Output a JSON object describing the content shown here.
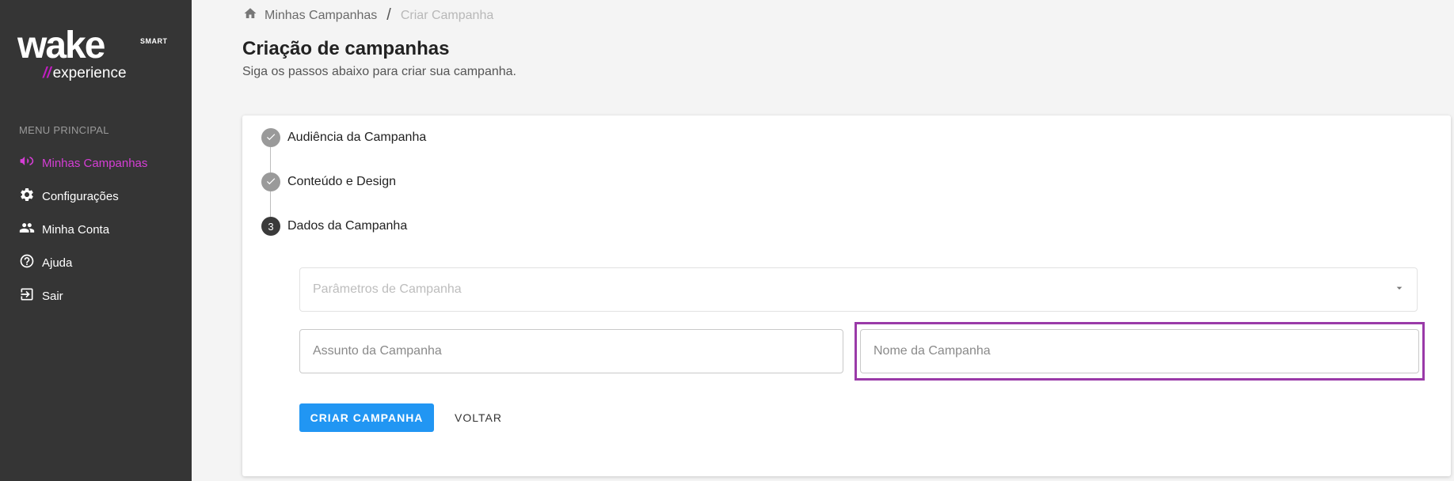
{
  "brand": {
    "logo_word": "wake",
    "logo_smart": "SMART",
    "logo_sub_slashes": "//",
    "logo_sub": "experience",
    "accent_color": "#c21ec2"
  },
  "sidebar": {
    "section_title": "MENU PRINCIPAL",
    "items": [
      {
        "label": "Minhas Campanhas",
        "icon": "megaphone-icon",
        "active": true
      },
      {
        "label": "Configurações",
        "icon": "gear-icon",
        "active": false
      },
      {
        "label": "Minha Conta",
        "icon": "people-icon",
        "active": false
      },
      {
        "label": "Ajuda",
        "icon": "help-circle-icon",
        "active": false
      },
      {
        "label": "Sair",
        "icon": "logout-icon",
        "active": false
      }
    ]
  },
  "breadcrumb": {
    "home_icon": "home-icon",
    "parent": "Minhas Campanhas",
    "separator": "/",
    "current": "Criar Campanha"
  },
  "page": {
    "title": "Criação de campanhas",
    "subtitle": "Siga os passos abaixo para criar sua campanha."
  },
  "stepper": {
    "steps": [
      {
        "label": "Audiência da Campanha",
        "state": "done",
        "icon": "check-icon"
      },
      {
        "label": "Conteúdo e Design",
        "state": "done",
        "icon": "check-icon"
      },
      {
        "label": "Dados da Campanha",
        "state": "current",
        "number": "3"
      }
    ]
  },
  "form": {
    "params_select": {
      "label": "Parâmetros de Campanha",
      "icon": "chevron-down-icon"
    },
    "subject_field": {
      "placeholder": "Assunto da Campanha",
      "value": ""
    },
    "name_field": {
      "placeholder": "Nome da Campanha",
      "value": ""
    },
    "submit_label": "CRIAR CAMPANHA",
    "back_label": "VOLTAR"
  },
  "colors": {
    "sidebar_bg": "#353535",
    "active_menu": "#d63ed6",
    "primary_button": "#2196f3",
    "highlight_border": "#9a3aa8"
  }
}
